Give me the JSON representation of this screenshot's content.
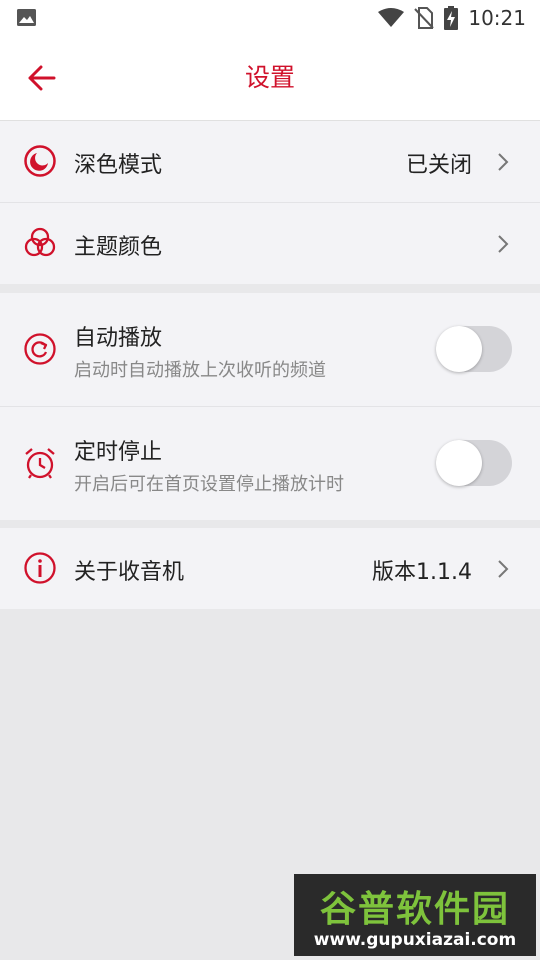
{
  "status_bar": {
    "time": "10:21",
    "icons": [
      "gallery-icon",
      "wifi-icon",
      "no-sim-icon",
      "battery-charging-icon"
    ]
  },
  "app_bar": {
    "title": "设置",
    "back_icon": "arrow-left-icon"
  },
  "colors": {
    "accent": "#d0112b",
    "background": "#e8e8ea",
    "row_background": "#f3f3f6",
    "toggle_off": "#d4d4d8"
  },
  "settings": {
    "dark_mode": {
      "label": "深色模式",
      "value": "已关闭",
      "icon": "moon-icon"
    },
    "theme_color": {
      "label": "主题颜色",
      "icon": "color-circles-icon"
    },
    "autoplay": {
      "label": "自动播放",
      "description": "启动时自动播放上次收听的频道",
      "icon": "replay-icon",
      "enabled": false
    },
    "timer_stop": {
      "label": "定时停止",
      "description": "开启后可在首页设置停止播放计时",
      "icon": "alarm-clock-icon",
      "enabled": false
    },
    "about": {
      "label": "关于收音机",
      "value": "版本1.1.4",
      "icon": "info-icon"
    }
  },
  "watermark": {
    "title": "谷普软件园",
    "url": "www.gupuxiazai.com"
  }
}
